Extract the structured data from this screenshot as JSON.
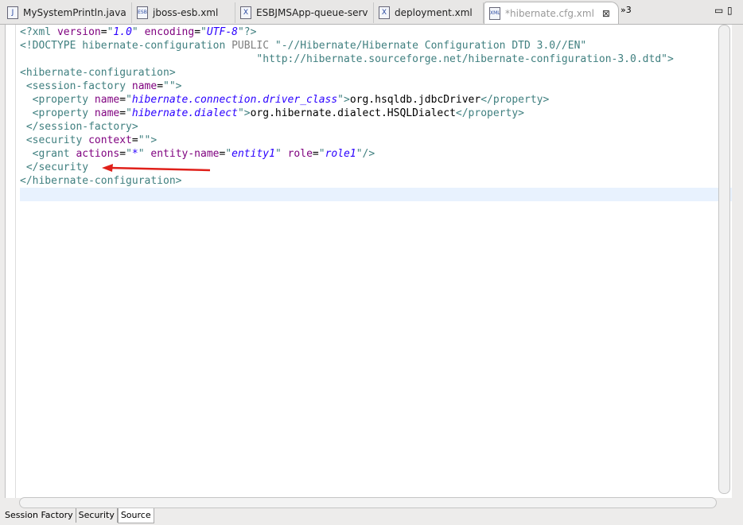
{
  "tabs": [
    {
      "label": "MySystemPrintln.java",
      "icon": "J"
    },
    {
      "label": "jboss-esb.xml",
      "icon": "ESB"
    },
    {
      "label": "ESBJMSApp-queue-serv",
      "icon": "X"
    },
    {
      "label": "deployment.xml",
      "icon": "X"
    },
    {
      "label": "*hibernate.cfg.xml",
      "icon": "XML",
      "active": true
    }
  ],
  "overflow_label": "»3",
  "code": [
    [
      [
        "tag",
        "<?xml "
      ],
      [
        "attr",
        "version"
      ],
      [
        "text",
        "="
      ],
      [
        "tag",
        "\""
      ],
      [
        "val",
        "1.0"
      ],
      [
        "tag",
        "\" "
      ],
      [
        "attr",
        "encoding"
      ],
      [
        "text",
        "="
      ],
      [
        "tag",
        "\""
      ],
      [
        "val",
        "UTF-8"
      ],
      [
        "tag",
        "\"?>"
      ]
    ],
    [
      [
        "tag",
        "<!DOCTYPE hibernate-configuration "
      ],
      [
        "kw",
        "PUBLIC"
      ],
      [
        "str",
        " \"-//Hibernate/Hibernate Configuration DTD 3.0//EN\""
      ]
    ],
    [
      [
        "str",
        "                                      \"http://hibernate.sourceforge.net/hibernate-configuration-3.0.dtd\">"
      ]
    ],
    [
      [
        "tag",
        "<hibernate-configuration>"
      ]
    ],
    [
      [
        "tag",
        " <session-factory "
      ],
      [
        "attr",
        "name"
      ],
      [
        "text",
        "="
      ],
      [
        "tag",
        "\"\">"
      ]
    ],
    [
      [
        "tag",
        "  <property "
      ],
      [
        "attr",
        "name"
      ],
      [
        "text",
        "="
      ],
      [
        "tag",
        "\""
      ],
      [
        "val",
        "hibernate.connection.driver_class"
      ],
      [
        "tag",
        "\">"
      ],
      [
        "text",
        "org.hsqldb.jdbcDriver"
      ],
      [
        "tag",
        "</property>"
      ]
    ],
    [
      [
        "tag",
        "  <property "
      ],
      [
        "attr",
        "name"
      ],
      [
        "text",
        "="
      ],
      [
        "tag",
        "\""
      ],
      [
        "val",
        "hibernate.dialect"
      ],
      [
        "tag",
        "\">"
      ],
      [
        "text",
        "org.hibernate.dialect.HSQLDialect"
      ],
      [
        "tag",
        "</property>"
      ]
    ],
    [
      [
        "tag",
        " </session-factory>"
      ]
    ],
    [
      [
        "tag",
        " <security "
      ],
      [
        "attr",
        "context"
      ],
      [
        "text",
        "="
      ],
      [
        "tag",
        "\"\">"
      ]
    ],
    [
      [
        "tag",
        "  <grant "
      ],
      [
        "attr",
        "actions"
      ],
      [
        "text",
        "="
      ],
      [
        "tag",
        "\""
      ],
      [
        "val",
        "*"
      ],
      [
        "tag",
        "\" "
      ],
      [
        "attr",
        "entity-name"
      ],
      [
        "text",
        "="
      ],
      [
        "tag",
        "\""
      ],
      [
        "val",
        "entity1"
      ],
      [
        "tag",
        "\" "
      ],
      [
        "attr",
        "role"
      ],
      [
        "text",
        "="
      ],
      [
        "tag",
        "\""
      ],
      [
        "val",
        "role1"
      ],
      [
        "tag",
        "\"/>"
      ]
    ],
    [
      [
        "tag",
        " </security"
      ]
    ],
    [
      [
        "tag",
        "</hibernate-configuration>"
      ]
    ],
    [
      [
        "text",
        ""
      ]
    ]
  ],
  "bottom_tabs": [
    "Session Factory",
    "Security",
    "Source"
  ],
  "active_bottom_tab": "Source"
}
